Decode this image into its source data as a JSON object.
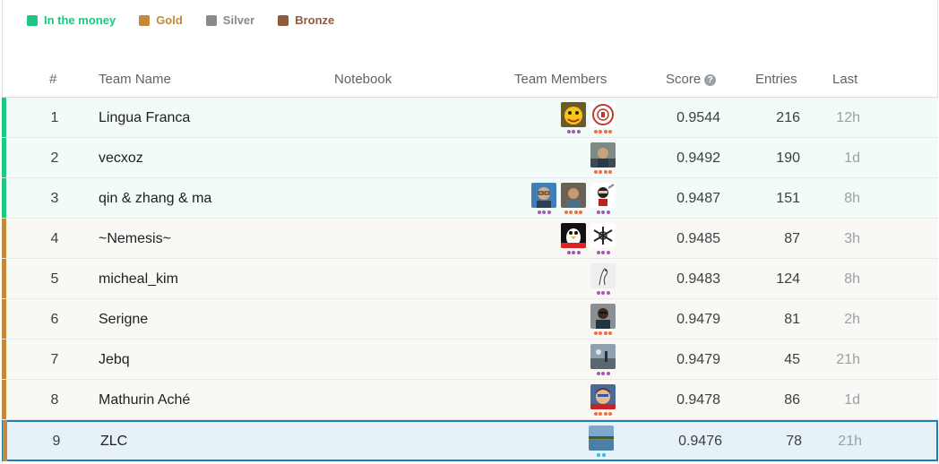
{
  "legend": [
    {
      "label": "In the money",
      "color": "#20BEFF",
      "swatch": "#1ec780",
      "text_color": "#1ec780"
    },
    {
      "label": "Gold",
      "swatch": "#c4893a",
      "text_color": "#c4893a"
    },
    {
      "label": "Silver",
      "swatch": "#8a8a8a",
      "text_color": "#8a8a8a"
    },
    {
      "label": "Bronze",
      "swatch": "#8e5b3f",
      "text_color": "#8e5b3f"
    }
  ],
  "header": {
    "rank": "#",
    "team_name": "Team Name",
    "notebook": "Notebook",
    "team_members": "Team Members",
    "score": "Score",
    "entries": "Entries",
    "last": "Last"
  },
  "colors": {
    "money": "#1ec780",
    "gold": "#c4893a",
    "self": "#1a7fb3",
    "dot_purple": "#a05ab4",
    "dot_orange": "#f26e3c",
    "dot_teal": "#20beff"
  },
  "rows": [
    {
      "rank": "1",
      "team": "Lingua Franca",
      "score": "0.9544",
      "entries": "216",
      "last": "12h",
      "tier": "money",
      "members": [
        {
          "avatar": "cartoon-avatar-yellow",
          "tier": "purple",
          "dots": 3
        },
        {
          "avatar": "crest-avatar-red",
          "tier": "orange",
          "dots": 4
        }
      ]
    },
    {
      "rank": "2",
      "team": "vecxoz",
      "score": "0.9492",
      "entries": "190",
      "last": "1d",
      "tier": "money",
      "members": [
        {
          "avatar": "photo-avatar-person",
          "tier": "orange",
          "dots": 4
        }
      ]
    },
    {
      "rank": "3",
      "team": "qin & zhang & ma",
      "score": "0.9487",
      "entries": "151",
      "last": "8h",
      "tier": "money",
      "members": [
        {
          "avatar": "photo-avatar-glasses",
          "tier": "purple",
          "dots": 3
        },
        {
          "avatar": "photo-avatar-person2",
          "tier": "orange",
          "dots": 4
        },
        {
          "avatar": "cartoon-avatar-ninja",
          "tier": "purple",
          "dots": 3
        }
      ]
    },
    {
      "rank": "4",
      "team": "~Nemesis~",
      "score": "0.9485",
      "entries": "87",
      "last": "3h",
      "tier": "gold",
      "members": [
        {
          "avatar": "cartoon-avatar-penguin",
          "tier": "purple",
          "dots": 3
        },
        {
          "avatar": "symbol-avatar-mask",
          "tier": "purple",
          "dots": 3
        }
      ]
    },
    {
      "rank": "5",
      "team": "micheal_kim",
      "score": "0.9483",
      "entries": "124",
      "last": "8h",
      "tier": "gold",
      "members": [
        {
          "avatar": "sketch-avatar-bird",
          "tier": "purple",
          "dots": 3
        }
      ]
    },
    {
      "rank": "6",
      "team": "Serigne",
      "score": "0.9479",
      "entries": "81",
      "last": "2h",
      "tier": "gold",
      "members": [
        {
          "avatar": "photo-avatar-dark",
          "tier": "orange",
          "dots": 4
        }
      ]
    },
    {
      "rank": "7",
      "team": "Jebq",
      "score": "0.9479",
      "entries": "45",
      "last": "21h",
      "tier": "gold",
      "members": [
        {
          "avatar": "photo-avatar-landscape",
          "tier": "purple",
          "dots": 3
        }
      ]
    },
    {
      "rank": "8",
      "team": "Mathurin Aché",
      "score": "0.9478",
      "entries": "86",
      "last": "1d",
      "tier": "gold",
      "members": [
        {
          "avatar": "cartoon-avatar-superhero",
          "tier": "orange",
          "dots": 4
        }
      ]
    },
    {
      "rank": "9",
      "team": "ZLC",
      "score": "0.9476",
      "entries": "78",
      "last": "21h",
      "tier": "self",
      "members": [
        {
          "avatar": "photo-avatar-lake",
          "tier": "teal",
          "dots": 2
        }
      ]
    }
  ]
}
